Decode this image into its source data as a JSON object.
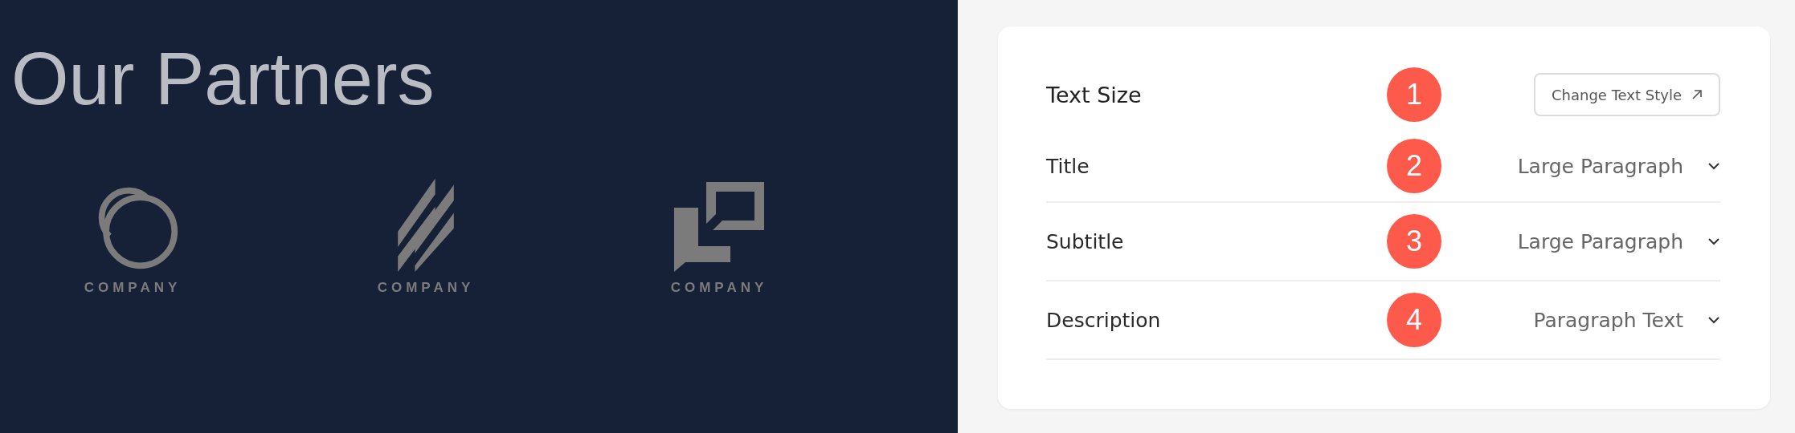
{
  "partners": {
    "heading": "Our Partners",
    "logos": [
      {
        "kind": "rings",
        "label": "COMPANY"
      },
      {
        "kind": "stripes",
        "label": "COMPANY"
      },
      {
        "kind": "squares",
        "label": "COMPANY"
      }
    ]
  },
  "panel": {
    "title": "Text Size",
    "badge": "1",
    "button": "Change Text Style",
    "rows": [
      {
        "label": "Title",
        "badge": "2",
        "value": "Large Paragraph"
      },
      {
        "label": "Subtitle",
        "badge": "3",
        "value": "Large Paragraph"
      },
      {
        "label": "Description",
        "badge": "4",
        "value": "Paragraph Text"
      }
    ]
  }
}
